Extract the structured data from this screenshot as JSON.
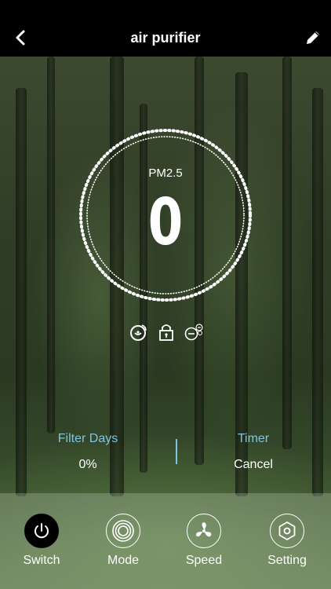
{
  "header": {
    "title": "air purifier",
    "back_icon": "chevron-left-icon",
    "edit_icon": "pencil-icon"
  },
  "gauge": {
    "label": "PM2.5",
    "value": "0"
  },
  "status_icons": [
    "fan-status-icon",
    "lock-icon",
    "ion-icon"
  ],
  "info": {
    "filter": {
      "label": "Filter Days",
      "value": "0%"
    },
    "timer": {
      "label": "Timer",
      "value": "Cancel"
    }
  },
  "controls": [
    {
      "label": "Switch",
      "icon": "power-icon"
    },
    {
      "label": "Mode",
      "icon": "mode-icon"
    },
    {
      "label": "Speed",
      "icon": "fan-icon"
    },
    {
      "label": "Setting",
      "icon": "hexagon-settings-icon"
    }
  ],
  "colors": {
    "accent": "#7fc4e0",
    "topbar": "#000000"
  }
}
